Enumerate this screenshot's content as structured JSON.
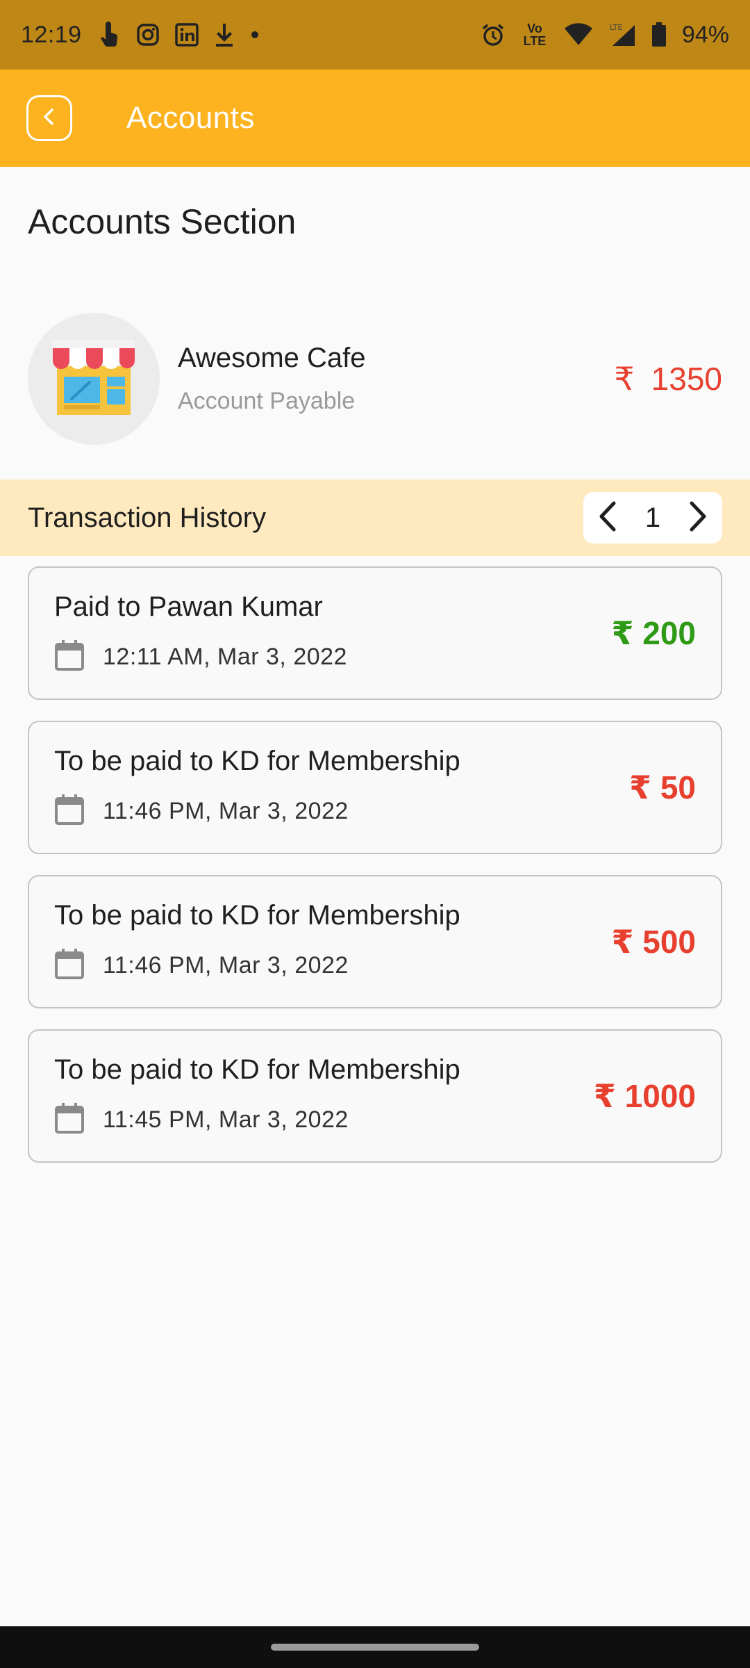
{
  "status_bar": {
    "time": "12:19",
    "battery": "94%",
    "lte_label": "Vo LTE"
  },
  "app_bar": {
    "title": "Accounts",
    "back_icon": "chevron-left-icon"
  },
  "section_title": "Accounts Section",
  "account": {
    "name": "Awesome Cafe",
    "type": "Account Payable",
    "currency": "₹",
    "amount": "1350",
    "icon": "store-icon"
  },
  "transactions_header": {
    "title": "Transaction History",
    "page": "1"
  },
  "transactions": [
    {
      "description": "Paid to Pawan Kumar",
      "date": "12:11 AM, Mar 3, 2022",
      "amount": "₹ 200",
      "status_color": "#2e9a16"
    },
    {
      "description": "To be paid to KD for Membership",
      "date": "11:46 PM, Mar 3, 2022",
      "amount": "₹ 50",
      "status_color": "#e8402f"
    },
    {
      "description": "To be paid to KD for Membership",
      "date": "11:46 PM, Mar 3, 2022",
      "amount": "₹ 500",
      "status_color": "#e8402f"
    },
    {
      "description": "To be paid to KD for Membership",
      "date": "11:45 PM, Mar 3, 2022",
      "amount": "₹ 1000",
      "status_color": "#e8402f"
    }
  ],
  "colors": {
    "status_bar": "#bf8716",
    "app_bar": "#fcb31f",
    "header_band": "#ffe9bf",
    "positive": "#2e9a16",
    "negative": "#e8402f"
  }
}
